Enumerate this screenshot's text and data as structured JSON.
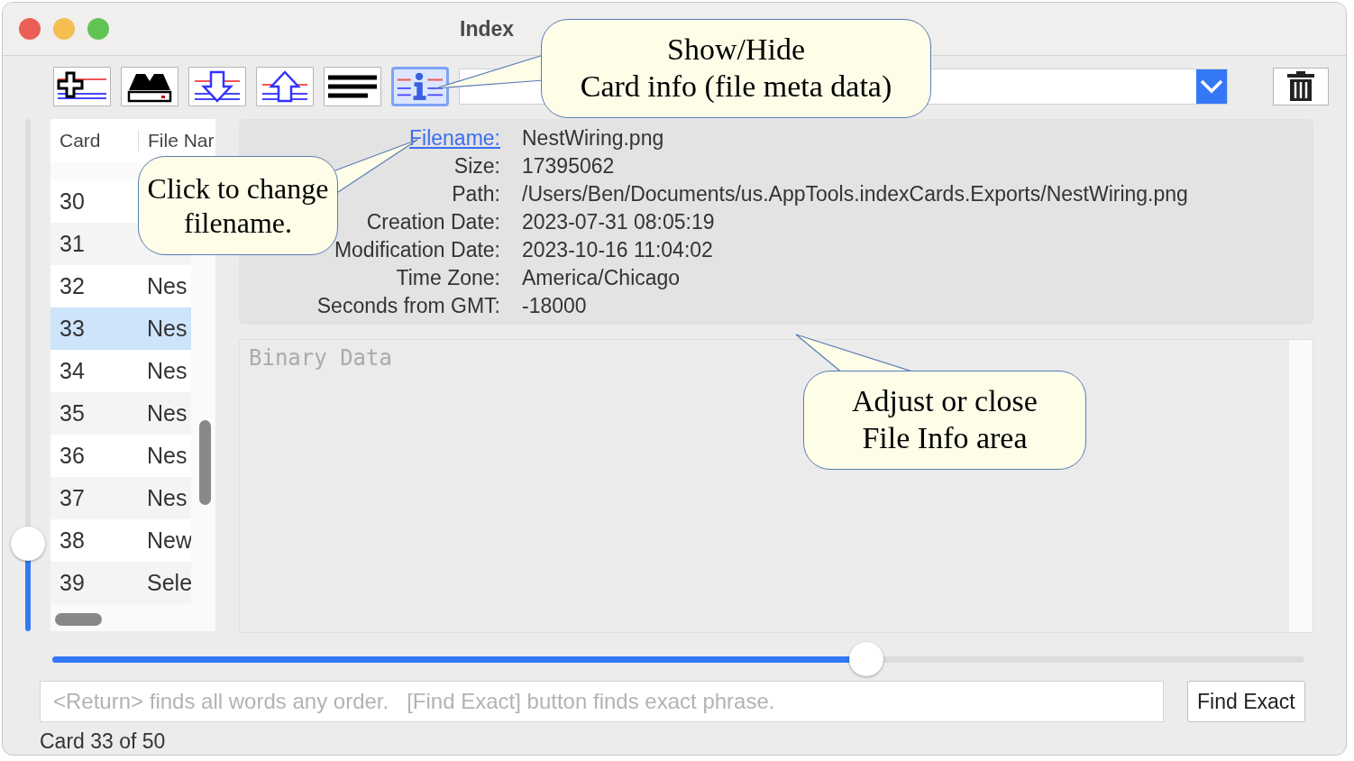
{
  "window": {
    "title": "Index"
  },
  "toolbar": {
    "buttons": [
      {
        "kind": "add",
        "on": false
      },
      {
        "kind": "import",
        "on": false
      },
      {
        "kind": "move-down",
        "on": false
      },
      {
        "kind": "move-up",
        "on": false
      },
      {
        "kind": "lines",
        "on": false
      },
      {
        "kind": "info",
        "on": true
      }
    ]
  },
  "card_slider": {
    "level": 0.17
  },
  "table": {
    "columns": [
      "Card",
      "File Nar"
    ],
    "rows": [
      {
        "card": "30",
        "selected": false
      },
      {
        "card": "31",
        "selected": false
      },
      {
        "card": "32",
        "file": "Nes",
        "selected": false
      },
      {
        "card": "33",
        "file": "Nes",
        "selected": true
      },
      {
        "card": "34",
        "file": "Nes",
        "selected": false
      },
      {
        "card": "35",
        "file": "Nes",
        "selected": false
      },
      {
        "card": "36",
        "file": "Nes",
        "selected": false
      },
      {
        "card": "37",
        "file": "Nes",
        "selected": false
      },
      {
        "card": "38",
        "file": "New",
        "selected": false
      },
      {
        "card": "39",
        "file": "Sele",
        "selected": false
      }
    ]
  },
  "file_info": [
    {
      "kind": "link",
      "label": "Filename:",
      "value": "NestWiring.png"
    },
    {
      "kind": "plain",
      "label": "Size:",
      "value": "17395062"
    },
    {
      "kind": "plain",
      "label": "Path:",
      "value": "/Users/Ben/Documents/us.AppTools.indexCards.Exports/NestWiring.png"
    },
    {
      "kind": "plain",
      "label": "Creation Date:",
      "value": "2023-07-31 08:05:19"
    },
    {
      "kind": "plain",
      "label": "Modification Date:",
      "value": "2023-10-16 11:04:02"
    },
    {
      "kind": "plain",
      "label": "Time Zone:",
      "value": "America/Chicago"
    },
    {
      "kind": "plain",
      "label": "Seconds from GMT:",
      "value": "-18000"
    }
  ],
  "binary_data": {
    "placeholder": "Binary Data"
  },
  "size_slider": {
    "level": 0.65
  },
  "search": {
    "placeholder": "<Return> finds all words any order.   [Find Exact] button finds exact phrase."
  },
  "find_button": "Find Exact",
  "status": "Card 33 of 50",
  "callouts": [
    {
      "lines": [
        "Show/Hide",
        "Card info (file meta data)"
      ]
    },
    {
      "lines": [
        "Click to change",
        "filename."
      ]
    },
    {
      "lines": [
        "Adjust or close",
        "File Info area"
      ]
    }
  ]
}
